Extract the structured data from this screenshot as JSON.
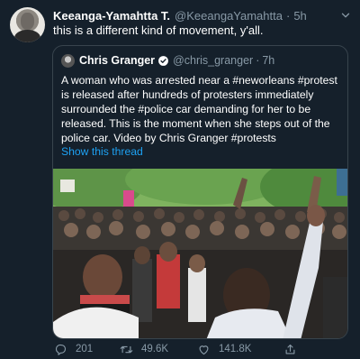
{
  "tweet": {
    "author_name": "Keeanga-Yamahtta T.",
    "author_handle": "@KeeangaYamahtta",
    "separator": "·",
    "time": "5h",
    "text": "this is a different kind of movement, y'all."
  },
  "quoted": {
    "author_name": "Chris Granger",
    "author_handle": "@chris_granger",
    "separator": "·",
    "time": "7h",
    "lines": [
      "A woman who was arrested near a #neworleans #protest",
      "is released after hundreds of protesters immediately",
      "surrounded the #police car demanding for her to be",
      "released. This is the moment when she steps out of the",
      "police car. Video by Chris Granger #protests"
    ],
    "show_thread": "Show this thread"
  },
  "actions": {
    "reply_count": "201",
    "retweet_count": "49.6K",
    "like_count": "141.8K"
  },
  "icons": {
    "more": "chevron-down-icon",
    "verified": "verified-badge-icon",
    "reply": "reply-icon",
    "retweet": "retweet-icon",
    "like": "heart-icon",
    "share": "share-icon"
  },
  "colors": {
    "background": "#15202b",
    "text_secondary": "#8899a6",
    "link": "#1da1f2",
    "border": "#38444d"
  }
}
